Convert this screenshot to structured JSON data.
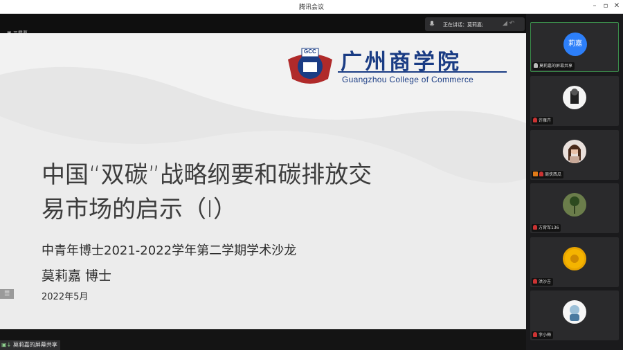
{
  "window": {
    "title": "腾讯会议"
  },
  "share_bar": {
    "speaking_label": "正在讲话：莫莉嘉;",
    "tab_label": "三屏幕"
  },
  "slide": {
    "logo_cn": "广州商学院",
    "logo_en": "Guangzhou College of Commerce",
    "logo_badge": "GCC",
    "title_line1": "中国“双碳”战略纲要和碳排放交",
    "title_line2": "易市场的启示（I）",
    "subtitle": "中青年博士2021-2022学年第二学期学术沙龙",
    "author": "莫莉嘉 博士",
    "date": "2022年5月"
  },
  "bottom": {
    "share_label": "莫莉嘉的屏幕共享"
  },
  "participants": [
    {
      "name": "莫莉嘉的屏幕共享",
      "avatar_text": "莉嘉",
      "avatar_color": "#2d7ff9"
    },
    {
      "name": "许雁卉"
    },
    {
      "name": "周侠西瓜"
    },
    {
      "name": "方霄军136"
    },
    {
      "name": "洪沙吉"
    },
    {
      "name": "李小梅"
    }
  ],
  "colors": {
    "brand_blue": "#1a3c84",
    "avatar_blue": "#2d7ff9",
    "active_border": "#3a8a4a"
  }
}
